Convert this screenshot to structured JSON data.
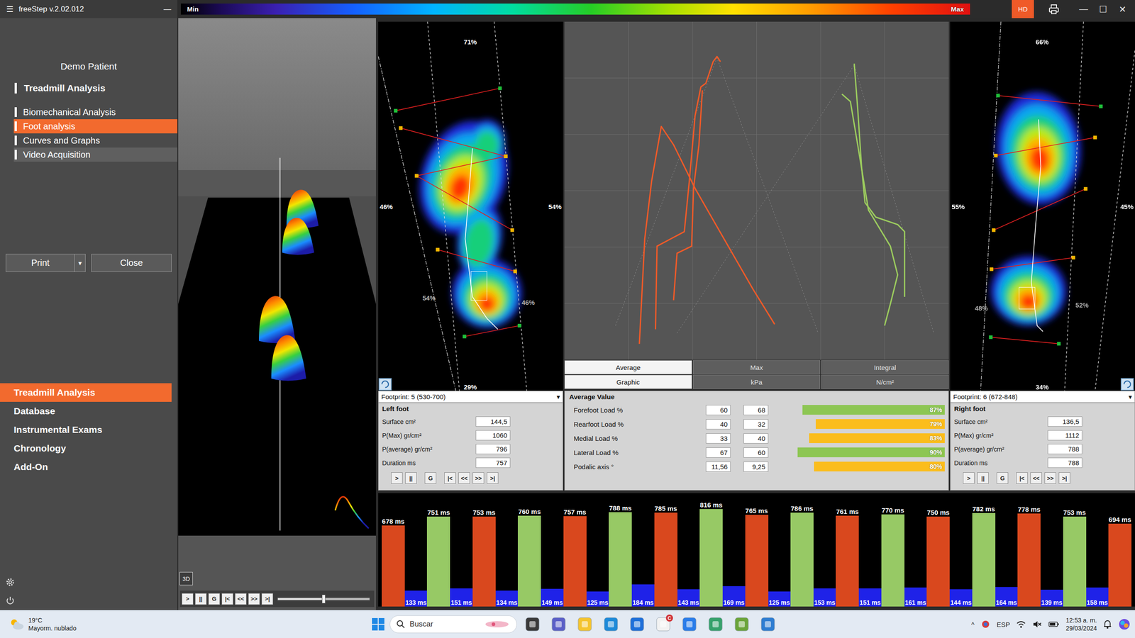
{
  "window": {
    "menu_icon": "☰",
    "title": "freeStep v.2.02.012",
    "sidebar_minimize": "—",
    "hd": "HD",
    "controls": [
      "—",
      "☐",
      "✕"
    ]
  },
  "scale": {
    "min": "Min",
    "max": "Max"
  },
  "sidebar": {
    "patient": "Demo Patient",
    "section": "Treadmill Analysis",
    "items": [
      {
        "label": "Biomechanical Analysis",
        "selected": false,
        "highlighted": false
      },
      {
        "label": "Foot analysis",
        "selected": true,
        "highlighted": false
      },
      {
        "label": "Curves and Graphs",
        "selected": false,
        "highlighted": false
      },
      {
        "label": "Video Acquisition",
        "selected": false,
        "highlighted": true
      }
    ],
    "buttons": [
      {
        "label": "Print",
        "dropdown": true
      },
      {
        "label": "Close",
        "dropdown": false
      }
    ],
    "dropdown_arrow": "▾",
    "menu": [
      {
        "label": "Treadmill Analysis",
        "selected": true
      },
      {
        "label": "Database",
        "selected": false
      },
      {
        "label": "Instrumental Exams",
        "selected": false
      },
      {
        "label": "Chronology",
        "selected": false
      },
      {
        "label": "Add-On",
        "selected": false
      }
    ]
  },
  "view3d": {
    "mode_button": "3D",
    "controls": [
      ">",
      "||",
      "G",
      "|<",
      "<<",
      ">>",
      ">|"
    ],
    "slider_level": 0.5
  },
  "feet": [
    {
      "side": "left",
      "percents": {
        "top": "71%",
        "left": "46%",
        "right": "54%",
        "rear_left": "54%",
        "rear_right": "46%",
        "bottom": "29%"
      },
      "footprint": "Footprint: 5 (530-700)",
      "arrow": "▾",
      "title": "Left foot",
      "stats": [
        {
          "label": "Surface cm²",
          "value": "144,5"
        },
        {
          "label": "P(Max) gr/cm²",
          "value": "1060"
        },
        {
          "label": "P(average) gr/cm²",
          "value": "796"
        },
        {
          "label": "Duration ms",
          "value": "757"
        }
      ],
      "controls": [
        ">",
        "||",
        "G",
        "|<",
        "<<",
        ">>",
        ">|"
      ]
    },
    {
      "side": "right",
      "percents": {
        "top": "66%",
        "left": "55%",
        "right": "45%",
        "rear_left": "48%",
        "rear_right": "52%",
        "bottom": "34%"
      },
      "footprint": "Footprint: 6 (672-848)",
      "arrow": "▾",
      "title": "Right foot",
      "stats": [
        {
          "label": "Surface cm²",
          "value": "136,5"
        },
        {
          "label": "P(Max) gr/cm²",
          "value": "1112"
        },
        {
          "label": "P(average) gr/cm²",
          "value": "788"
        },
        {
          "label": "Duration ms",
          "value": "788"
        }
      ],
      "controls": [
        ">",
        "||",
        "G",
        "|<",
        "<<",
        ">>",
        ">|"
      ]
    }
  ],
  "graph": {
    "series": [
      {
        "kind": "guide",
        "color": "#8a8a8a",
        "points": [
          [
            13.3,
            89.9
          ],
          [
            39.7,
            10.7
          ],
          [
            66.0,
            92.1
          ]
        ]
      },
      {
        "kind": "guide",
        "color": "#8a8a8a",
        "points": [
          [
            29.3,
            92.1
          ],
          [
            75.4,
            12.8
          ],
          [
            96.1,
            92.1
          ]
        ]
      },
      {
        "kind": "curve",
        "color": "#f05a28",
        "points": [
          [
            19.5,
            95.3
          ],
          [
            20.9,
            64.2
          ],
          [
            22.7,
            47.1
          ],
          [
            25.2,
            31.0
          ],
          [
            28.4,
            36.4
          ],
          [
            34.0,
            49.3
          ],
          [
            41.5,
            64.2
          ],
          [
            49.1,
            79.2
          ],
          [
            54.7,
            89.5
          ]
        ]
      },
      {
        "kind": "curve",
        "color": "#f05a28",
        "points": [
          [
            23.7,
            91.0
          ],
          [
            24.1,
            66.4
          ],
          [
            31.2,
            62.1
          ],
          [
            32.5,
            47.1
          ],
          [
            34.0,
            27.8
          ],
          [
            35.5,
            19.3
          ],
          [
            36.8,
            18.2
          ],
          [
            38.7,
            11.8
          ],
          [
            39.7,
            10.3
          ],
          [
            40.6,
            11.8
          ]
        ]
      },
      {
        "kind": "curve",
        "color": "#f05a28",
        "points": [
          [
            28.4,
            82.4
          ],
          [
            29.3,
            68.5
          ],
          [
            33.1,
            66.4
          ],
          [
            33.6,
            49.3
          ],
          [
            35.0,
            36.4
          ],
          [
            35.9,
            20.3
          ]
        ]
      },
      {
        "kind": "curve",
        "color": "#9ccc5e",
        "points": [
          [
            75.4,
            12.4
          ],
          [
            76.3,
            25.7
          ],
          [
            77.3,
            42.8
          ],
          [
            78.2,
            53.5
          ],
          [
            81.0,
            57.8
          ],
          [
            86.7,
            60.0
          ],
          [
            88.5,
            62.1
          ],
          [
            88.5,
            81.4
          ]
        ]
      },
      {
        "kind": "curve",
        "color": "#9ccc5e",
        "points": [
          [
            72.2,
            21.4
          ],
          [
            74.4,
            23.6
          ],
          [
            76.3,
            36.4
          ],
          [
            79.1,
            55.7
          ],
          [
            84.8,
            66.4
          ],
          [
            86.7,
            74.9
          ],
          [
            84.8,
            83.5
          ],
          [
            83.3,
            89.9
          ]
        ]
      }
    ]
  },
  "tabs": [
    [
      {
        "label": "Average",
        "selected": true
      },
      {
        "label": "Max",
        "selected": false
      },
      {
        "label": "Integral",
        "selected": false
      }
    ],
    [
      {
        "label": "Graphic",
        "selected": true
      },
      {
        "label": "kPa",
        "selected": false
      },
      {
        "label": "N/cm²",
        "selected": false
      }
    ]
  ],
  "average": {
    "title": "Average Value",
    "rows": [
      {
        "label": "Forefoot Load %",
        "left": "60",
        "right": "68",
        "reading": "87%",
        "level": 0.87,
        "color": "#8dc653"
      },
      {
        "label": "Rearfoot Load %",
        "left": "40",
        "right": "32",
        "reading": "79%",
        "level": 0.79,
        "color": "#fbbd1c"
      },
      {
        "label": "Medial Load %",
        "left": "33",
        "right": "40",
        "reading": "83%",
        "level": 0.83,
        "color": "#fbbd1c"
      },
      {
        "label": "Lateral Load %",
        "left": "67",
        "right": "60",
        "reading": "90%",
        "level": 0.9,
        "color": "#8dc653"
      },
      {
        "label": "Podalic axis °",
        "left": "11,56",
        "right": "9,25",
        "reading": "80%",
        "level": 0.8,
        "color": "#fbbd1c"
      }
    ]
  },
  "steps": {
    "bars": [
      {
        "value": 678,
        "label": "678 ms",
        "color": "#d9481e"
      },
      {
        "value": 751,
        "label": "751 ms",
        "color": "#97c965"
      },
      {
        "value": 753,
        "label": "753 ms",
        "color": "#d9481e"
      },
      {
        "value": 760,
        "label": "760 ms",
        "color": "#97c965"
      },
      {
        "value": 757,
        "label": "757 ms",
        "color": "#d9481e"
      },
      {
        "value": 788,
        "label": "788 ms",
        "color": "#97c965"
      },
      {
        "value": 785,
        "label": "785 ms",
        "color": "#d9481e"
      },
      {
        "value": 816,
        "label": "816 ms",
        "color": "#97c965"
      },
      {
        "value": 765,
        "label": "765 ms",
        "color": "#d9481e"
      },
      {
        "value": 786,
        "label": "786 ms",
        "color": "#97c965"
      },
      {
        "value": 761,
        "label": "761 ms",
        "color": "#d9481e"
      },
      {
        "value": 770,
        "label": "770 ms",
        "color": "#97c965"
      },
      {
        "value": 750,
        "label": "750 ms",
        "color": "#d9481e"
      },
      {
        "value": 782,
        "label": "782 ms",
        "color": "#97c965"
      },
      {
        "value": 778,
        "label": "778 ms",
        "color": "#d9481e"
      },
      {
        "value": 753,
        "label": "753 ms",
        "color": "#97c965"
      },
      {
        "value": 694,
        "label": "694 ms",
        "color": "#d9481e"
      }
    ],
    "swings": [
      {
        "value": 133,
        "label": "133 ms"
      },
      {
        "value": 151,
        "label": "151 ms"
      },
      {
        "value": 134,
        "label": "134 ms"
      },
      {
        "value": 149,
        "label": "149 ms"
      },
      {
        "value": 125,
        "label": "125 ms"
      },
      {
        "value": 184,
        "label": "184 ms"
      },
      {
        "value": 143,
        "label": "143 ms"
      },
      {
        "value": 169,
        "label": "169 ms"
      },
      {
        "value": 125,
        "label": "125 ms"
      },
      {
        "value": 153,
        "label": "153 ms"
      },
      {
        "value": 151,
        "label": "151 ms"
      },
      {
        "value": 161,
        "label": "161 ms"
      },
      {
        "value": 144,
        "label": "144 ms"
      },
      {
        "value": 164,
        "label": "164 ms"
      },
      {
        "value": 139,
        "label": "139 ms"
      },
      {
        "value": 158,
        "label": "158 ms"
      }
    ]
  },
  "taskbar": {
    "temp": "19°C",
    "weather": "Mayorm. nublado",
    "search": "Buscar",
    "badge": "C",
    "chevron": "^",
    "lang": "ESP",
    "time": "12:53 a. m.",
    "date": "29/03/2024"
  }
}
